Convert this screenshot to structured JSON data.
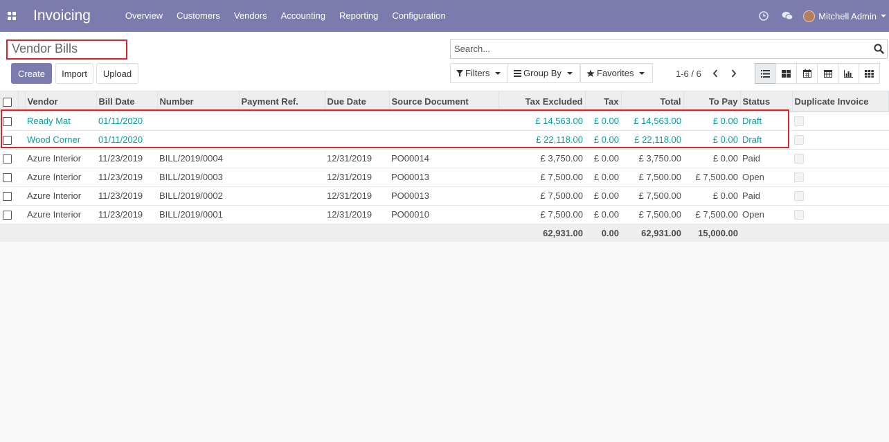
{
  "navbar": {
    "app_title": "Invoicing",
    "menu": [
      "Overview",
      "Customers",
      "Vendors",
      "Accounting",
      "Reporting",
      "Configuration"
    ],
    "user_name": "Mitchell Admin"
  },
  "breadcrumb": {
    "title": "Vendor Bills"
  },
  "buttons": {
    "create": "Create",
    "import": "Import",
    "upload": "Upload"
  },
  "search": {
    "placeholder": "Search..."
  },
  "filters": {
    "filters": "Filters",
    "group_by": "Group By",
    "favorites": "Favorites"
  },
  "pager": {
    "text": "1-6 / 6"
  },
  "table": {
    "headers": [
      "Vendor",
      "Bill Date",
      "Number",
      "Payment Ref.",
      "Due Date",
      "Source Document",
      "Tax Excluded",
      "Tax",
      "Total",
      "To Pay",
      "Status",
      "Duplicate Invoice"
    ],
    "rows": [
      {
        "vendor": "Ready Mat",
        "bill_date": "01/11/2020",
        "number": "",
        "payment_ref": "",
        "due_date": "",
        "source": "",
        "tax_excluded": "£ 14,563.00",
        "tax": "£ 0.00",
        "total": "£ 14,563.00",
        "to_pay": "£ 0.00",
        "status": "Draft"
      },
      {
        "vendor": "Wood Corner",
        "bill_date": "01/11/2020",
        "number": "",
        "payment_ref": "",
        "due_date": "",
        "source": "",
        "tax_excluded": "£ 22,118.00",
        "tax": "£ 0.00",
        "total": "£ 22,118.00",
        "to_pay": "£ 0.00",
        "status": "Draft"
      },
      {
        "vendor": "Azure Interior",
        "bill_date": "11/23/2019",
        "number": "BILL/2019/0004",
        "payment_ref": "",
        "due_date": "12/31/2019",
        "source": "PO00014",
        "tax_excluded": "£ 3,750.00",
        "tax": "£ 0.00",
        "total": "£ 3,750.00",
        "to_pay": "£ 0.00",
        "status": "Paid"
      },
      {
        "vendor": "Azure Interior",
        "bill_date": "11/23/2019",
        "number": "BILL/2019/0003",
        "payment_ref": "",
        "due_date": "12/31/2019",
        "source": "PO00013",
        "tax_excluded": "£ 7,500.00",
        "tax": "£ 0.00",
        "total": "£ 7,500.00",
        "to_pay": "£ 7,500.00",
        "status": "Open"
      },
      {
        "vendor": "Azure Interior",
        "bill_date": "11/23/2019",
        "number": "BILL/2019/0002",
        "payment_ref": "",
        "due_date": "12/31/2019",
        "source": "PO00013",
        "tax_excluded": "£ 7,500.00",
        "tax": "£ 0.00",
        "total": "£ 7,500.00",
        "to_pay": "£ 0.00",
        "status": "Paid"
      },
      {
        "vendor": "Azure Interior",
        "bill_date": "11/23/2019",
        "number": "BILL/2019/0001",
        "payment_ref": "",
        "due_date": "12/31/2019",
        "source": "PO00010",
        "tax_excluded": "£ 7,500.00",
        "tax": "£ 0.00",
        "total": "£ 7,500.00",
        "to_pay": "£ 7,500.00",
        "status": "Open"
      }
    ],
    "totals": {
      "tax_excluded": "62,931.00",
      "tax": "0.00",
      "total": "62,931.00",
      "to_pay": "15,000.00"
    }
  },
  "colors": {
    "navbar": "#7c7bad",
    "draft_text": "#00a09d",
    "highlight": "#e0212a"
  }
}
